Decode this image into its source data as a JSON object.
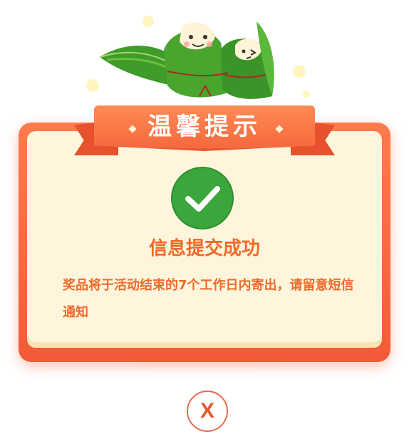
{
  "dialog": {
    "ribbon_title": "温馨提示",
    "success_title": "信息提交成功",
    "message": "奖品将于活动结束的7个工作日内寄出，请留意短信通知",
    "close_label": "X"
  },
  "icons": {
    "success": "check-circle-icon",
    "decoration": "zongzi-illustration",
    "close": "close-icon"
  },
  "colors": {
    "frame": "#f25a38",
    "card_bg": "#fff5dc",
    "accent_text": "#f06a2a",
    "success_green": "#3aa63b",
    "ribbon": "#f4673c"
  }
}
